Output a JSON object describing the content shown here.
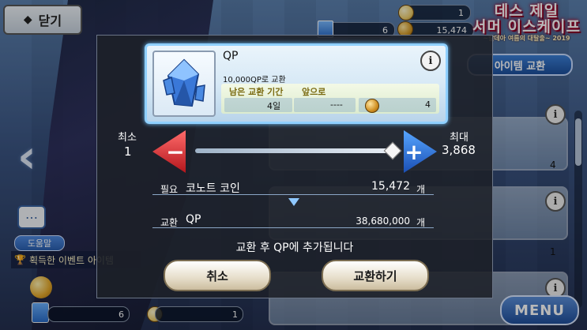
{
  "header": {
    "close_label": "닫기",
    "resource_top": "1",
    "resource_ticket": "6",
    "resource_qp": "15,474"
  },
  "logo": {
    "line1": "데스 제일",
    "line2": "서머 이스케이프",
    "line3": "~칼데아 여름의 대탈출~ 2019"
  },
  "right_panel": {
    "tab_label": "아이템 교환",
    "card_values": [
      "4",
      "1"
    ]
  },
  "left_panel": {
    "help_label": "도움말",
    "event_text": "획득한 이벤트 아이템"
  },
  "bottom": {
    "count_a": "6",
    "count_b": "1",
    "menu_label": "MENU"
  },
  "dialog": {
    "item": {
      "name": "QP",
      "description": "10,000QP로 교환",
      "remaining_label": "남은 교환 기간",
      "remaining_value": "4일",
      "until_label": "앞으로",
      "until_value": "----",
      "owned_value": "4",
      "icon": "blue-crystal-icon"
    },
    "min_label": "최소",
    "min_value": "1",
    "max_label": "최대",
    "max_value": "3,868",
    "required": {
      "label": "필요",
      "name": "코노트 코인",
      "amount": "15,472",
      "unit": "개"
    },
    "exchange": {
      "label": "교환",
      "name": "QP",
      "amount": "38,680,000",
      "unit": "개"
    },
    "note": "교환 후 QP에 추가됩니다",
    "cancel_label": "취소",
    "confirm_label": "교환하기",
    "slider_fraction": 1.0
  }
}
